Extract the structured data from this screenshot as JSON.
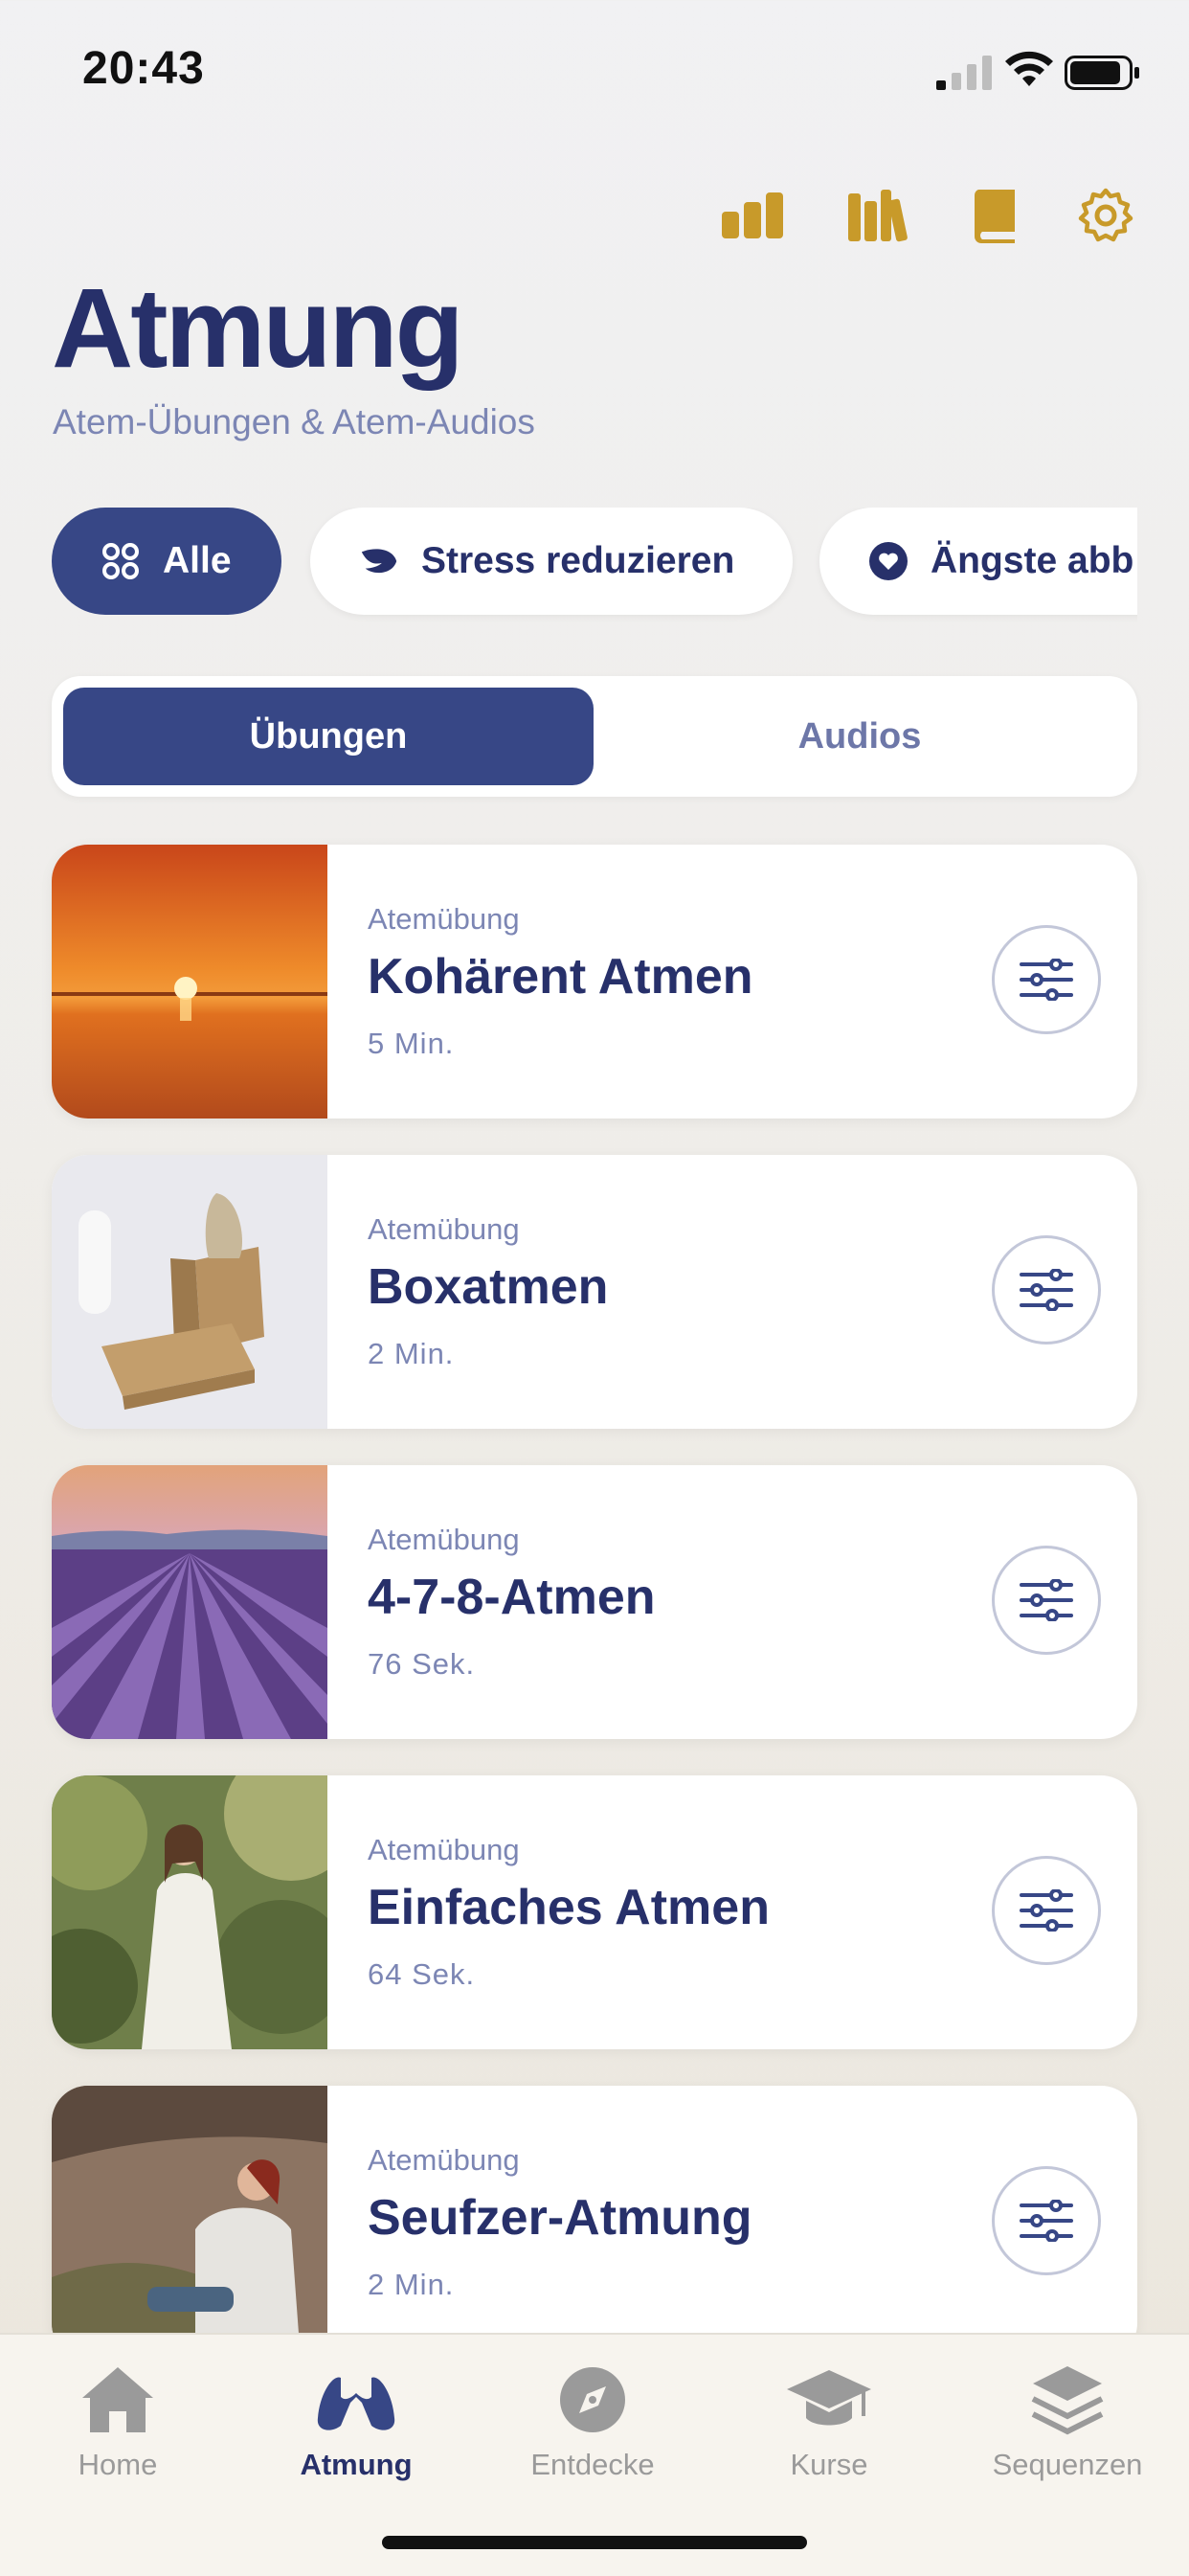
{
  "status_bar": {
    "time": "20:43"
  },
  "header": {
    "title": "Atmung",
    "subtitle": "Atem-Übungen & Atem-Audios",
    "top_icons": [
      "stats-icon",
      "library-icon",
      "book-icon",
      "gear-icon"
    ]
  },
  "filters": {
    "chips": [
      {
        "label": "Alle",
        "icon": "grid-icon",
        "active": true
      },
      {
        "label": "Stress reduzieren",
        "icon": "leaf-icon",
        "active": false
      },
      {
        "label": "Ängste abb",
        "icon": "heart-icon",
        "active": false
      }
    ]
  },
  "segment": {
    "options": [
      "Übungen",
      "Audios"
    ],
    "selected": "Übungen"
  },
  "exercises": [
    {
      "category": "Atemübung",
      "title": "Kohärent Atmen",
      "duration": "5 Min."
    },
    {
      "category": "Atemübung",
      "title": "Boxatmen",
      "duration": "2 Min."
    },
    {
      "category": "Atemübung",
      "title": "4-7-8-Atmen",
      "duration": "76 Sek."
    },
    {
      "category": "Atemübung",
      "title": "Einfaches Atmen",
      "duration": "64 Sek."
    },
    {
      "category": "Atemübung",
      "title": "Seufzer-Atmung",
      "duration": "2 Min."
    }
  ],
  "tabbar": {
    "tabs": [
      {
        "label": "Home",
        "icon": "home-icon"
      },
      {
        "label": "Atmung",
        "icon": "lungs-icon"
      },
      {
        "label": "Entdecke",
        "icon": "compass-icon"
      },
      {
        "label": "Kurse",
        "icon": "graduation-cap-icon"
      },
      {
        "label": "Sequenzen",
        "icon": "layers-icon"
      }
    ],
    "active": "Atmung"
  },
  "colors": {
    "primary": "#374786",
    "gold": "#c89a2a",
    "text_dark": "#27306a",
    "text_muted": "#7c86b4"
  }
}
